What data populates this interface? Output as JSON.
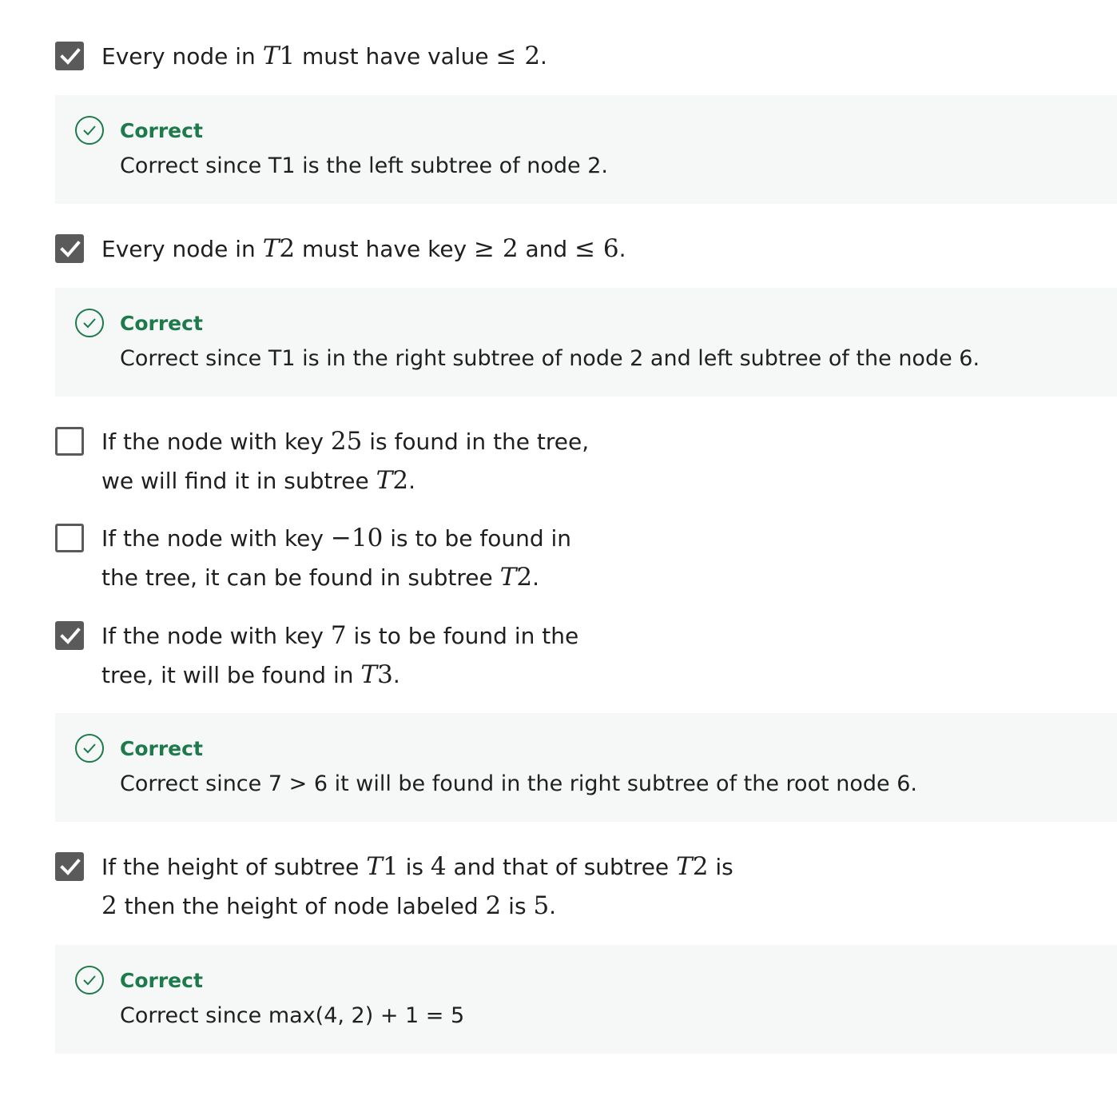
{
  "options": [
    {
      "checked": true,
      "parts": [
        {
          "t": "text",
          "v": "Every node in "
        },
        {
          "t": "math",
          "v": "T1"
        },
        {
          "t": "text",
          "v": " must have value "
        },
        {
          "t": "math",
          "v": "≤ 2"
        },
        {
          "t": "text",
          "v": "."
        }
      ],
      "feedback": {
        "status": "Correct",
        "text": "Correct since T1 is the left subtree of node 2."
      }
    },
    {
      "checked": true,
      "parts": [
        {
          "t": "text",
          "v": "Every node in "
        },
        {
          "t": "math",
          "v": "T2"
        },
        {
          "t": "text",
          "v": " must have key "
        },
        {
          "t": "math",
          "v": "≥ 2"
        },
        {
          "t": "text",
          "v": " and "
        },
        {
          "t": "math",
          "v": "≤ 6"
        },
        {
          "t": "text",
          "v": "."
        }
      ],
      "feedback": {
        "status": "Correct",
        "text": "Correct since T1 is in the right subtree of node 2 and left subtree of the node 6."
      }
    },
    {
      "checked": false,
      "parts": [
        {
          "t": "text",
          "v": "If the node with key "
        },
        {
          "t": "math",
          "v": "25"
        },
        {
          "t": "text",
          "v": " is found in the tree, we will find it in subtree "
        },
        {
          "t": "math",
          "v": "T2"
        },
        {
          "t": "text",
          "v": "."
        }
      ]
    },
    {
      "checked": false,
      "parts": [
        {
          "t": "text",
          "v": "If the node with key "
        },
        {
          "t": "math",
          "v": "−10"
        },
        {
          "t": "text",
          "v": " is to be found in the tree, it can be found in subtree "
        },
        {
          "t": "math",
          "v": "T2"
        },
        {
          "t": "text",
          "v": "."
        }
      ]
    },
    {
      "checked": true,
      "parts": [
        {
          "t": "text",
          "v": "If the node with key "
        },
        {
          "t": "math",
          "v": "7"
        },
        {
          "t": "text",
          "v": " is to be found in the tree, it will be found in "
        },
        {
          "t": "math",
          "v": "T3"
        },
        {
          "t": "text",
          "v": "."
        }
      ],
      "feedback": {
        "status": "Correct",
        "text": "Correct since 7 > 6 it will be found in the right subtree of the root node 6."
      }
    },
    {
      "checked": true,
      "parts": [
        {
          "t": "text",
          "v": "If the height of subtree "
        },
        {
          "t": "math",
          "v": "T1"
        },
        {
          "t": "text",
          "v": " is "
        },
        {
          "t": "math",
          "v": "4"
        },
        {
          "t": "text",
          "v": " and that of subtree "
        },
        {
          "t": "math",
          "v": "T2"
        },
        {
          "t": "text",
          "v": " is "
        },
        {
          "t": "math",
          "v": "2"
        },
        {
          "t": "text",
          "v": " then the height of node labeled "
        },
        {
          "t": "math",
          "v": "2"
        },
        {
          "t": "text",
          "v": " is "
        },
        {
          "t": "math",
          "v": "5"
        },
        {
          "t": "text",
          "v": "."
        }
      ],
      "feedback": {
        "status": "Correct",
        "text": "Correct since max(4, 2) + 1 = 5"
      }
    }
  ],
  "colors": {
    "checkbox": "#5a5a5a",
    "correct": "#1e7a4c",
    "feedback_bg": "#f5f8f7"
  },
  "icons": {
    "checkbox_checked": "check-icon",
    "feedback_status": "check-circle-icon"
  }
}
